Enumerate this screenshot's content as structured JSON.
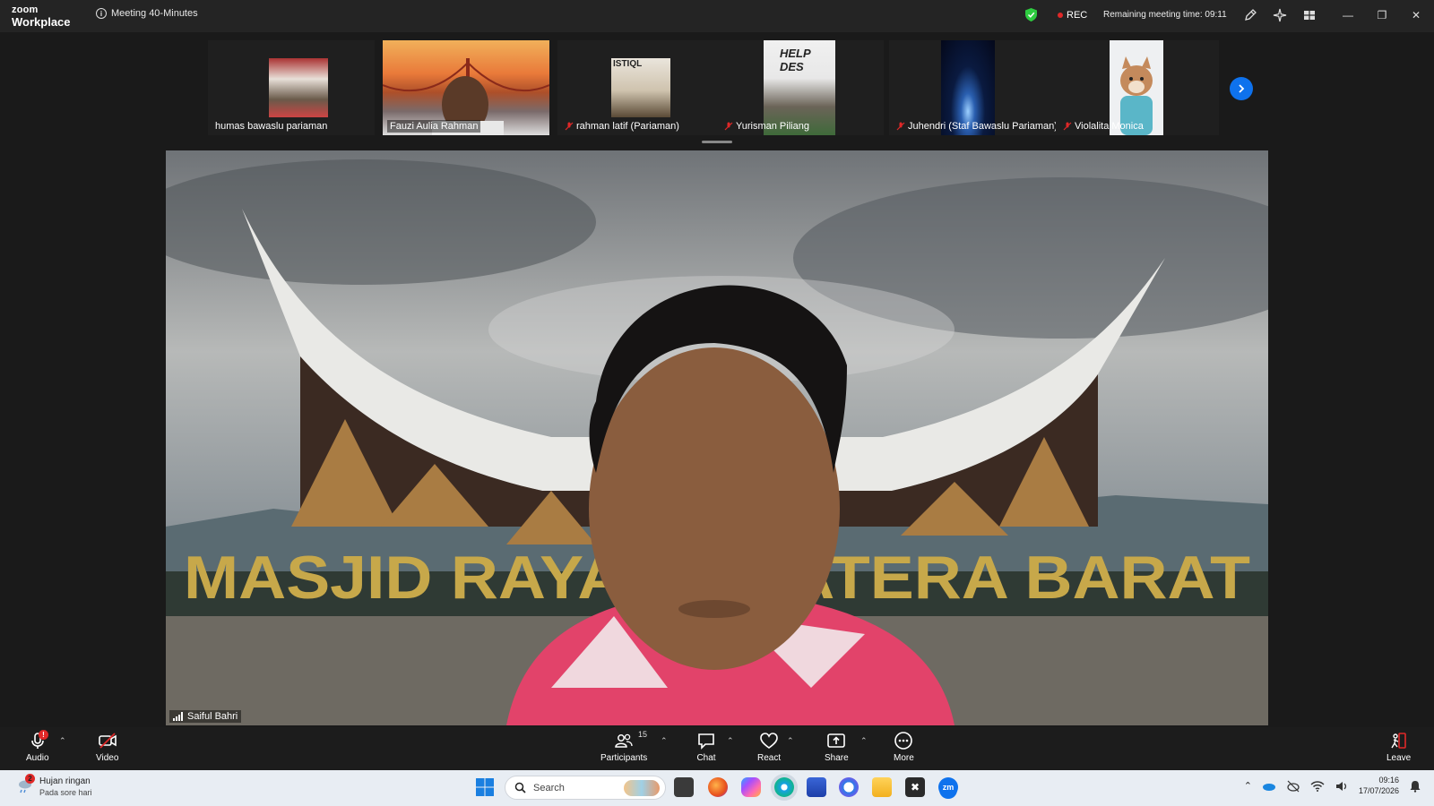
{
  "app": {
    "logo_top": "zoom",
    "logo_bottom": "Workplace",
    "meeting_title": "Meeting 40-Minutes",
    "rec_label": "REC",
    "remaining_time": "Remaining meeting time: 09:11"
  },
  "participants_strip": [
    {
      "name": "humas bawaslu pariaman",
      "muted": false
    },
    {
      "name": "Fauzi Aulia Rahman",
      "muted": false
    },
    {
      "name": "rahman latif (Pariaman)",
      "muted": true
    },
    {
      "name": "Yurisman Piliang",
      "muted": true
    },
    {
      "name": "Juhendri (Staf Bawaslu Pariaman)",
      "muted": true
    },
    {
      "name": "Violalita Monica",
      "muted": true
    }
  ],
  "thumbnail_texts": {
    "banner_sign": "ISTIQL",
    "help_sign": "HELP DES"
  },
  "main_video": {
    "speaker": "Saiful Bahri",
    "sign_text": "MASJID RAYA SUMATERA BARAT"
  },
  "toolbar": {
    "audio_label": "Audio",
    "audio_badge": "!",
    "video_label": "Video",
    "participants_label": "Participants",
    "participants_count": "15",
    "chat_label": "Chat",
    "react_label": "React",
    "share_label": "Share",
    "more_label": "More",
    "leave_label": "Leave"
  },
  "taskbar": {
    "weather_badge": "2",
    "weather_title": "Hujan ringan",
    "weather_sub": "Pada sore hari",
    "search_placeholder": "Search",
    "time": "09:16",
    "date": "17/07/2026"
  },
  "colors": {
    "accent_blue": "#0e72ed",
    "rec_red": "#e02828",
    "shield_green": "#2ecc40",
    "muted_red": "#e02828"
  }
}
